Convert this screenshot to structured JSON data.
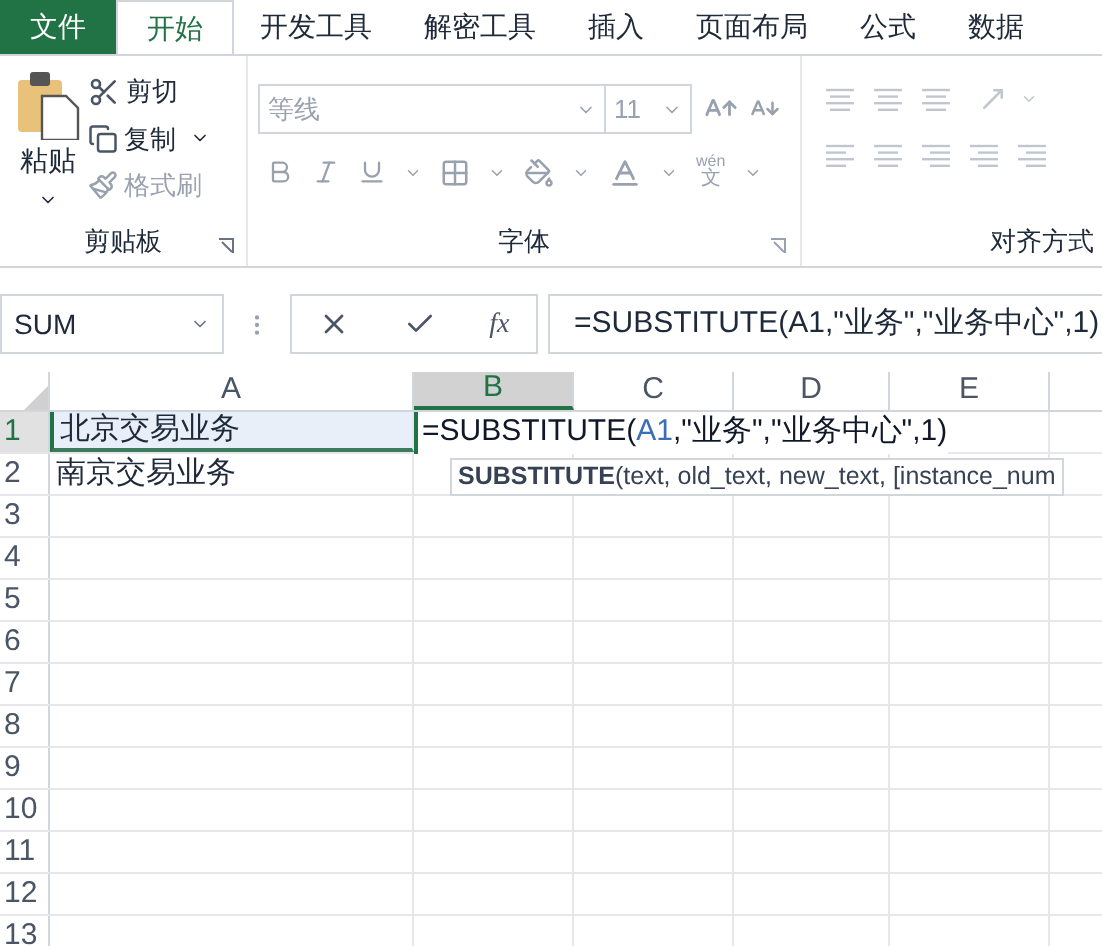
{
  "tabs": [
    {
      "label": "文件",
      "kind": "file",
      "selected": false
    },
    {
      "label": "开始",
      "kind": "tab",
      "selected": true
    },
    {
      "label": "开发工具",
      "kind": "tab",
      "selected": false
    },
    {
      "label": "解密工具",
      "kind": "tab",
      "selected": false
    },
    {
      "label": "插入",
      "kind": "tab",
      "selected": false
    },
    {
      "label": "页面布局",
      "kind": "tab",
      "selected": false
    },
    {
      "label": "公式",
      "kind": "tab",
      "selected": false
    },
    {
      "label": "数据",
      "kind": "tab",
      "selected": false
    }
  ],
  "clipboard": {
    "label": "剪贴板",
    "paste": "粘贴",
    "cut": "剪切",
    "copy": "复制",
    "format_painter": {
      "label": "格式刷",
      "disabled": true
    }
  },
  "font": {
    "label": "字体",
    "disabled": true,
    "font_name": "等线",
    "font_size": "11",
    "phonetic_reading": "wén",
    "phonetic_char": "文"
  },
  "alignment": {
    "label": "对齐方式",
    "disabled": true
  },
  "formula_bar": {
    "name_box": "SUM",
    "function_label": "fx",
    "formula": "=SUBSTITUTE(A1,\"业务\",\"业务中心\",1)"
  },
  "sheet": {
    "columns": [
      {
        "label": "A",
        "selected": false
      },
      {
        "label": "B",
        "selected": true
      },
      {
        "label": "C",
        "selected": false
      },
      {
        "label": "D",
        "selected": false
      },
      {
        "label": "E",
        "selected": false
      }
    ],
    "rows": [
      {
        "label": "1",
        "selected": true,
        "cells": [
          {
            "text": "北京交易业务",
            "highlighted": true
          }
        ]
      },
      {
        "label": "2",
        "selected": false,
        "cells": [
          {
            "text": "南京交易业务",
            "highlighted": false
          }
        ]
      },
      {
        "label": "3",
        "selected": false
      },
      {
        "label": "4",
        "selected": false
      },
      {
        "label": "5",
        "selected": false
      },
      {
        "label": "6",
        "selected": false
      },
      {
        "label": "7",
        "selected": false
      },
      {
        "label": "8",
        "selected": false
      },
      {
        "label": "9",
        "selected": false
      },
      {
        "label": "10",
        "selected": false
      },
      {
        "label": "11",
        "selected": false
      },
      {
        "label": "12",
        "selected": false
      },
      {
        "label": "13",
        "selected": false
      }
    ],
    "editing_cell": {
      "parts": [
        {
          "text": "=SUBSTITUTE(",
          "kind": "plain"
        },
        {
          "text": "A1",
          "kind": "ref"
        },
        {
          "text": ",\"业务\",\"业务中心\",1)",
          "kind": "plain"
        }
      ]
    },
    "tooltip": "**SUBSTITUTE**(text, old_text, new_text, [instance_num"
  }
}
